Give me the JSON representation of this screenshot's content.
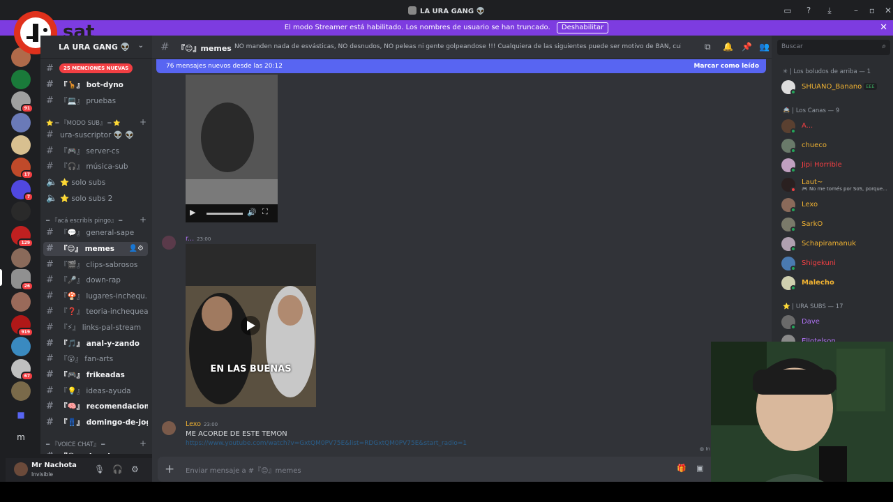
{
  "window": {
    "title": "LA URA GANG 👽"
  },
  "streamer_notice": {
    "text": "El modo Streamer está habilitado. Los nombres de usuario se han truncado.",
    "button": "Deshabilitar"
  },
  "overlay_logo": {
    "text": "sat"
  },
  "server": {
    "name": "LA URA GANG 👽",
    "mentions_badge": "25 MENCIONES NUEVAS"
  },
  "rail": {
    "badges": [
      "91",
      "17",
      "7",
      "129",
      "26",
      "919",
      "67"
    ],
    "letter": "m"
  },
  "channels": [
    {
      "label": "bot-dyno",
      "prefix": "『🦒』"
    },
    {
      "label": "pruebas",
      "prefix": "『💻』"
    },
    {
      "label": "ura-suscriptor 👽 👽",
      "prefix": ""
    },
    {
      "label": "server-cs",
      "prefix": "『🎮』"
    },
    {
      "label": "música-sub",
      "prefix": "『🎧』"
    },
    {
      "label": "solo subs",
      "prefix": "⭐"
    },
    {
      "label": "solo subs 2",
      "prefix": "⭐"
    },
    {
      "label": "general-sape",
      "prefix": "『💬』"
    },
    {
      "label": "memes",
      "prefix": "『😊』"
    },
    {
      "label": "clips-sabrosos",
      "prefix": "『🎬』"
    },
    {
      "label": "down-rap",
      "prefix": "『🎤』"
    },
    {
      "label": "lugares-inchequ...",
      "prefix": "『🍄』"
    },
    {
      "label": "teoria-inchequea...",
      "prefix": "『❓』"
    },
    {
      "label": "links-pal-stream",
      "prefix": "『⚡』"
    },
    {
      "label": "anal-y-zando",
      "prefix": "『🎵』"
    },
    {
      "label": "fan-arts",
      "prefix": "『😮』"
    },
    {
      "label": "frikeadas",
      "prefix": "『🎮』"
    },
    {
      "label": "ideas-ayuda",
      "prefix": "『💡』"
    },
    {
      "label": "recomendaciones",
      "prefix": "『🧠』"
    },
    {
      "label": "domingo-de-joggin",
      "prefix": "『👖』"
    },
    {
      "label": "sin-mic",
      "prefix": "『😶』"
    }
  ],
  "categories": {
    "modo_sub": "⭐ ━ 『MODO SUB』 ━ ⭐",
    "pingo": "━ 『acá escribís pingo』 ━",
    "voice": "━ 『VOICE CHAT』 ━"
  },
  "user": {
    "name": "Mr Nachota",
    "status": "Invisible"
  },
  "channel_header": {
    "name": "『😊』memes",
    "topic": "NO manden nada de esvásticas, NO desnudos, NO peleas ni gente golpeandose !!! Cualquiera de las siguientes puede ser motivo de BAN, cuiden el stream!"
  },
  "search": {
    "placeholder": "Buscar"
  },
  "new_messages": {
    "text": "76 mensajes nuevos desde las 20:12",
    "mark": "Marcar como leído"
  },
  "messages": [
    {
      "author": "r...",
      "time": "23:00",
      "caption": "EN LAS BUENAS"
    },
    {
      "author": "Lexo",
      "time": "23:00",
      "text": "ME ACORDE DE ESTE TEMON",
      "link": "https://www.youtube.com/watch?v=GxtQM0PV75E&list=RDGxtQM0PV75E&start_radio=1",
      "hint": "In"
    }
  ],
  "composer": {
    "placeholder": "Enviar mensaje a #『😊』memes"
  },
  "member_groups": [
    {
      "label": "✳ | Los boludos de arriba — 1"
    },
    {
      "label": "🚔 | Los Canas — 9"
    },
    {
      "label": "⭐ | URA SUBS — 17"
    }
  ],
  "members": [
    {
      "name": "SHUANO_Banano",
      "tag": "EEE",
      "color": "#f0b232"
    },
    {
      "name": "A...",
      "color": "#f23f43"
    },
    {
      "name": "chueco",
      "color": "#f0b232"
    },
    {
      "name": "Jipi Horrible",
      "color": "#f23f43"
    },
    {
      "name": "Laut~",
      "sub": "🎮 No me tomés por SoS, porque...",
      "color": "#f0b232"
    },
    {
      "name": "Lexo",
      "color": "#f0b232"
    },
    {
      "name": "SarkO",
      "color": "#f0b232"
    },
    {
      "name": "Schapiramanuk",
      "color": "#f0b232"
    },
    {
      "name": "Shigekuni",
      "color": "#f23f43"
    },
    {
      "name": "Malecho",
      "color": "#f0b232"
    },
    {
      "name": "Dave",
      "color": "#b073f5"
    },
    {
      "name": "ElJotelson",
      "color": "#b073f5"
    }
  ]
}
